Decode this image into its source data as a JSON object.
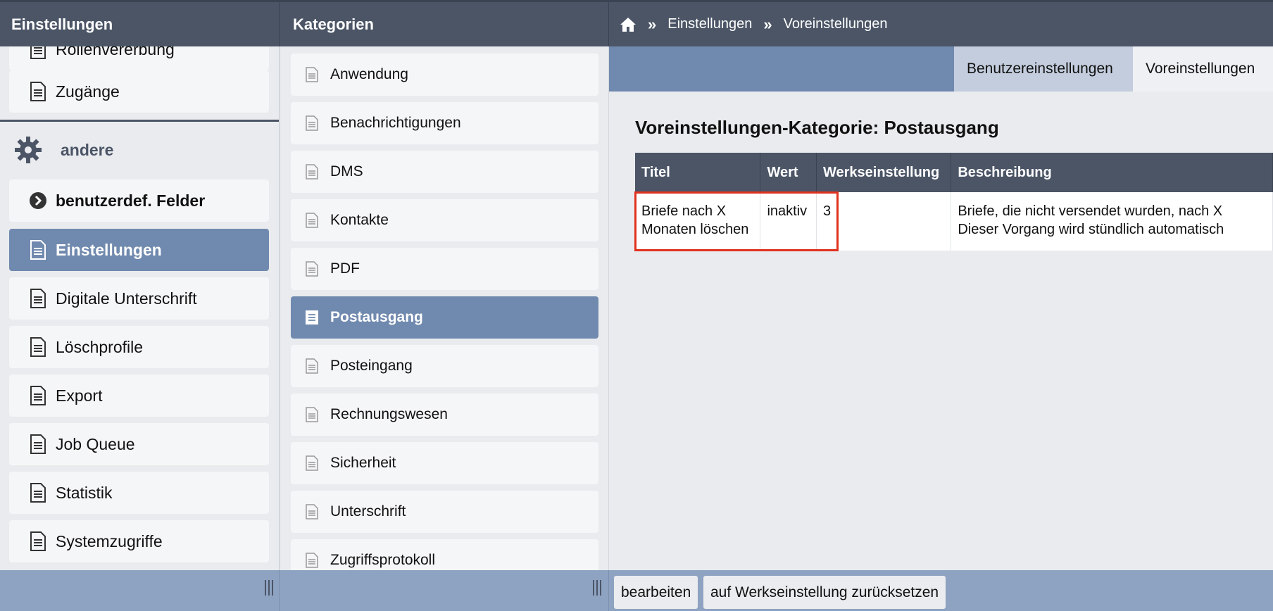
{
  "header": {
    "left_title": "Einstellungen",
    "middle_title": "Kategorien",
    "breadcrumb": [
      "Einstellungen",
      "Voreinstellungen"
    ],
    "separator": "»"
  },
  "sidebar": {
    "items_top": [
      {
        "label": "Rollenvererbung"
      },
      {
        "label": "Zugänge"
      }
    ],
    "group": {
      "label": "andere",
      "icon": "gear-icon"
    },
    "items": [
      {
        "label": "benutzerdef. Felder",
        "icon": "chevron-circle-icon"
      },
      {
        "label": "Einstellungen",
        "active": true
      },
      {
        "label": "Digitale Unterschrift"
      },
      {
        "label": "Löschprofile"
      },
      {
        "label": "Export"
      },
      {
        "label": "Job Queue"
      },
      {
        "label": "Statistik"
      },
      {
        "label": "Systemzugriffe"
      }
    ]
  },
  "categories": [
    {
      "label": "Anwendung"
    },
    {
      "label": "Benachrichtigungen"
    },
    {
      "label": "DMS"
    },
    {
      "label": "Kontakte"
    },
    {
      "label": "PDF"
    },
    {
      "label": "Postausgang",
      "active": true
    },
    {
      "label": "Posteingang"
    },
    {
      "label": "Rechnungswesen"
    },
    {
      "label": "Sicherheit"
    },
    {
      "label": "Unterschrift"
    },
    {
      "label": "Zugriffsprotokoll"
    }
  ],
  "tabs": [
    {
      "label": "Benutzereinstellungen",
      "active": false
    },
    {
      "label": "Voreinstellungen",
      "active": true
    }
  ],
  "main": {
    "heading": "Voreinstellungen-Kategorie: Postausgang",
    "columns": [
      "Titel",
      "Wert",
      "Werkseinstellung",
      "Beschreibung"
    ],
    "rows": [
      {
        "titel": "Briefe nach X Monaten löschen",
        "wert": "inaktiv",
        "werkseinstellung": "3",
        "beschreibung_line1": "Briefe, die nicht versendet wurden, nach X",
        "beschreibung_line2": "Dieser Vorgang wird stündlich automatisch"
      }
    ]
  },
  "footer": {
    "edit_label": "bearbeiten",
    "reset_label": "auf Werkseinstellung zurücksetzen"
  },
  "colors": {
    "header_bg": "#4b5566",
    "accent": "#7089ae",
    "highlight": "#e0321e"
  }
}
